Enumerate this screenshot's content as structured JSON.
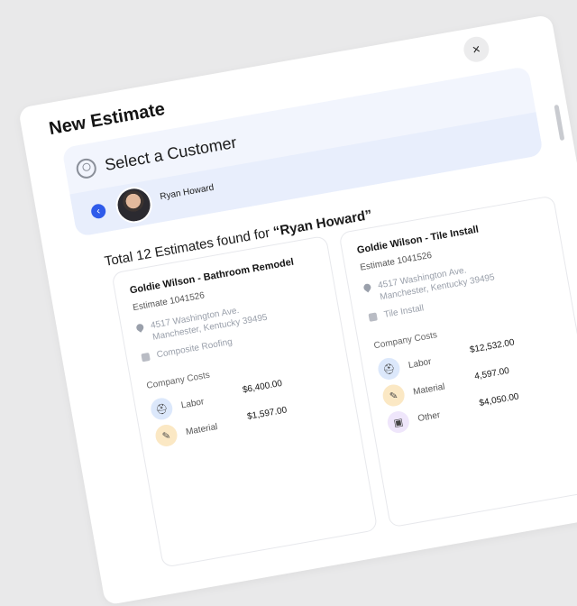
{
  "modal": {
    "title": "New Estimate",
    "close_icon": "×"
  },
  "customer": {
    "heading": "Select a Customer",
    "selected_name": "Ryan Howard",
    "back_icon": "‹"
  },
  "results": {
    "prefix": "Total 12 Estimates found for ",
    "query": "“Ryan Howard”"
  },
  "company_costs_label": "Company Costs",
  "cards": [
    {
      "title": "Goldie Wilson - Bathroom Remodel",
      "estimate": "Estimate 1041526",
      "address": "4517 Washington Ave. Manchester, Kentucky 39495",
      "type": "Composite Roofing",
      "costs": [
        {
          "label": "Labor",
          "value": "$6,400.00"
        },
        {
          "label": "Material",
          "value": "$1,597.00"
        }
      ]
    },
    {
      "title": "Goldie Wilson - Tile Install",
      "estimate": "Estimate 1041526",
      "address": "4517 Washington Ave. Manchester, Kentucky 39495",
      "type": "Tile Install",
      "costs": [
        {
          "label": "Labor",
          "value": "$12,532.00"
        },
        {
          "label": "Material",
          "value": "4,597.00"
        },
        {
          "label": "Other",
          "value": "$4,050.00"
        }
      ]
    }
  ],
  "colors": {
    "accent": "#2f5bea",
    "labor": "#dce8fb",
    "material": "#fbe8c4",
    "other": "#efe6fb"
  }
}
